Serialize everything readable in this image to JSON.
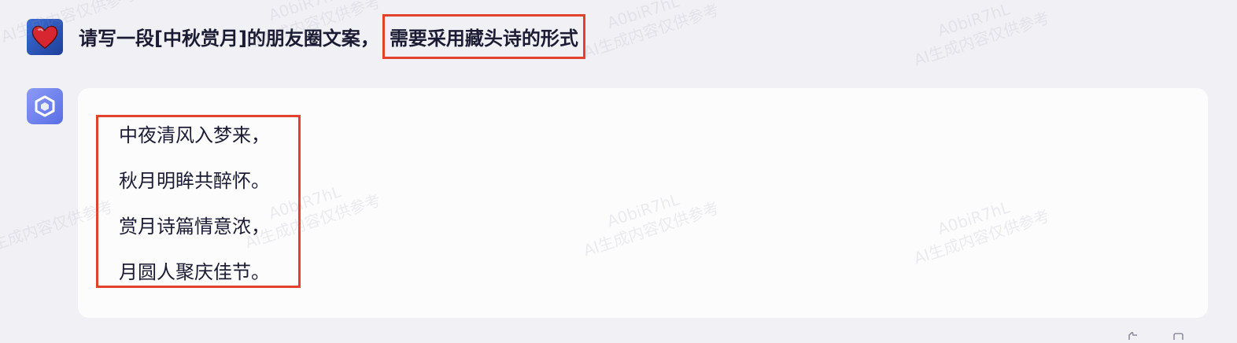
{
  "conversation": {
    "user_message": {
      "prefix": "请写一段[中秋赏月]的朋友圈文案，",
      "highlighted": "需要采用藏头诗的形式"
    },
    "reply": {
      "lines": [
        "中夜清风入梦来，",
        "秋月明眸共醉怀。",
        "赏月诗篇情意浓，",
        "月圆人聚庆佳节。"
      ]
    }
  },
  "watermark": {
    "code": "A0biR7hL",
    "text": "AI生成内容仅供参考"
  },
  "colors": {
    "highlight_border": "#e2412d",
    "bot_avatar": "#7283ef",
    "user_avatar": "#2d56bf",
    "heart": "#d7262f"
  },
  "icons": {
    "user_avatar": "heart-icon",
    "bot_avatar": "cube-logo-icon"
  }
}
